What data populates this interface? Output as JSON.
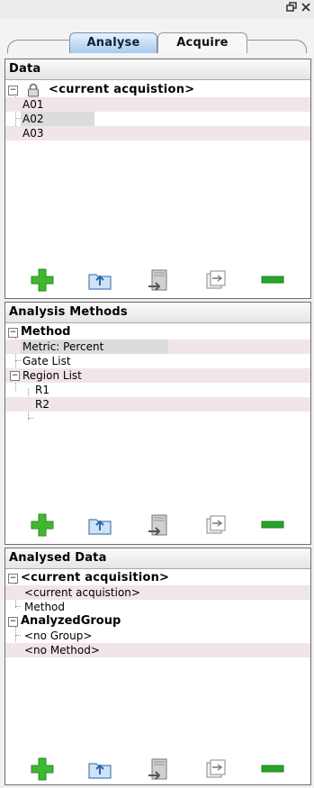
{
  "window": {
    "restore_glyph": "🗗",
    "close_glyph": "✕"
  },
  "tabs": [
    {
      "label": "Analyse",
      "active": true
    },
    {
      "label": "Acquire",
      "active": false
    }
  ],
  "panels": {
    "data": {
      "title": "Data",
      "root": "<current acquistion>",
      "items": [
        "A01",
        "A02",
        "A03"
      ],
      "selected_item": "A02"
    },
    "methods": {
      "title": "Analysis Methods",
      "root": "Method",
      "items": [
        "Metric: Percent",
        "Gate List",
        "Region List"
      ],
      "region_items": [
        "R1",
        "R2"
      ],
      "selected_item": "Metric: Percent"
    },
    "analysed": {
      "title": "Analysed Data",
      "groups": [
        {
          "label": "<current acquisition>",
          "children": [
            "<current acquistion>",
            "Method"
          ]
        },
        {
          "label": "AnalyzedGroup",
          "children": [
            "<no Group>",
            "<no Method>"
          ]
        }
      ]
    }
  },
  "toolbar_icons": [
    "add-icon",
    "open-folder-icon",
    "import-icon",
    "copy-icon",
    "remove-icon"
  ],
  "colors": {
    "tab_active": "#a7c9ef",
    "row_stripe": "#f0e5e7",
    "add_green": "#3fb830",
    "remove_green": "#27a52a"
  }
}
